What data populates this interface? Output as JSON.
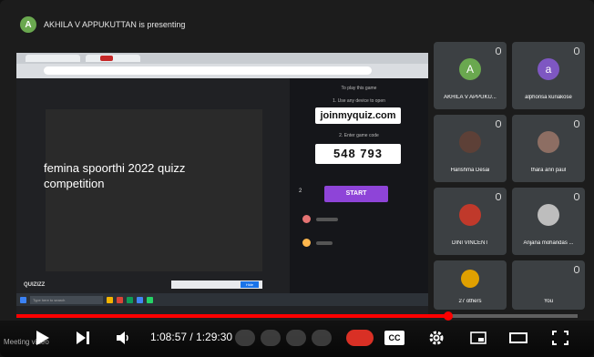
{
  "meeting": {
    "presenter_initial": "A",
    "presenter_banner": "AKHILA V APPUKUTTAN is presenting"
  },
  "slide": {
    "title": "femina spoorthi 2022 quizz competition"
  },
  "quiz_panel": {
    "instruction_1": "To play this game",
    "instruction_2": "1. Use any device to open",
    "join_url": "joinmyquiz.com",
    "instruction_3": "2. Enter game code",
    "game_code": "548 793",
    "start_label": "START",
    "player_count": "2",
    "logo": "QUIZIZZ"
  },
  "taskbar": {
    "search_placeholder": "Type here to search",
    "notice_hide": "Hide"
  },
  "participants": [
    {
      "name": "AKHILA V APPUKU...",
      "initial": "A",
      "color": "#6aa84f"
    },
    {
      "name": "alphonsa kuriakose",
      "initial": "a",
      "color": "#7e57c2"
    },
    {
      "name": "Harishma Desai",
      "initial": "",
      "color": "#5d4037"
    },
    {
      "name": "thara ann paul",
      "initial": "",
      "color": "#8d6e63"
    },
    {
      "name": "DINI VINCENT",
      "initial": "",
      "color": "#c0392b"
    },
    {
      "name": "Anjana mohandas ...",
      "initial": "",
      "color": "#bdbdbd"
    },
    {
      "name": "27 others",
      "initial": "",
      "color": "#e0a000"
    },
    {
      "name": "You",
      "initial": "",
      "color": "#3c4043"
    }
  ],
  "player": {
    "current_time": "1:08:57",
    "duration": "1:29:30",
    "time_display": "1:08:57 / 1:29:30",
    "progress_fraction": 0.77,
    "cc_label": "CC",
    "hint_text": "Meeting video"
  },
  "colors": {
    "progress": "#ff0000",
    "start_button": "#8e44d8",
    "hangup": "#d93025"
  }
}
